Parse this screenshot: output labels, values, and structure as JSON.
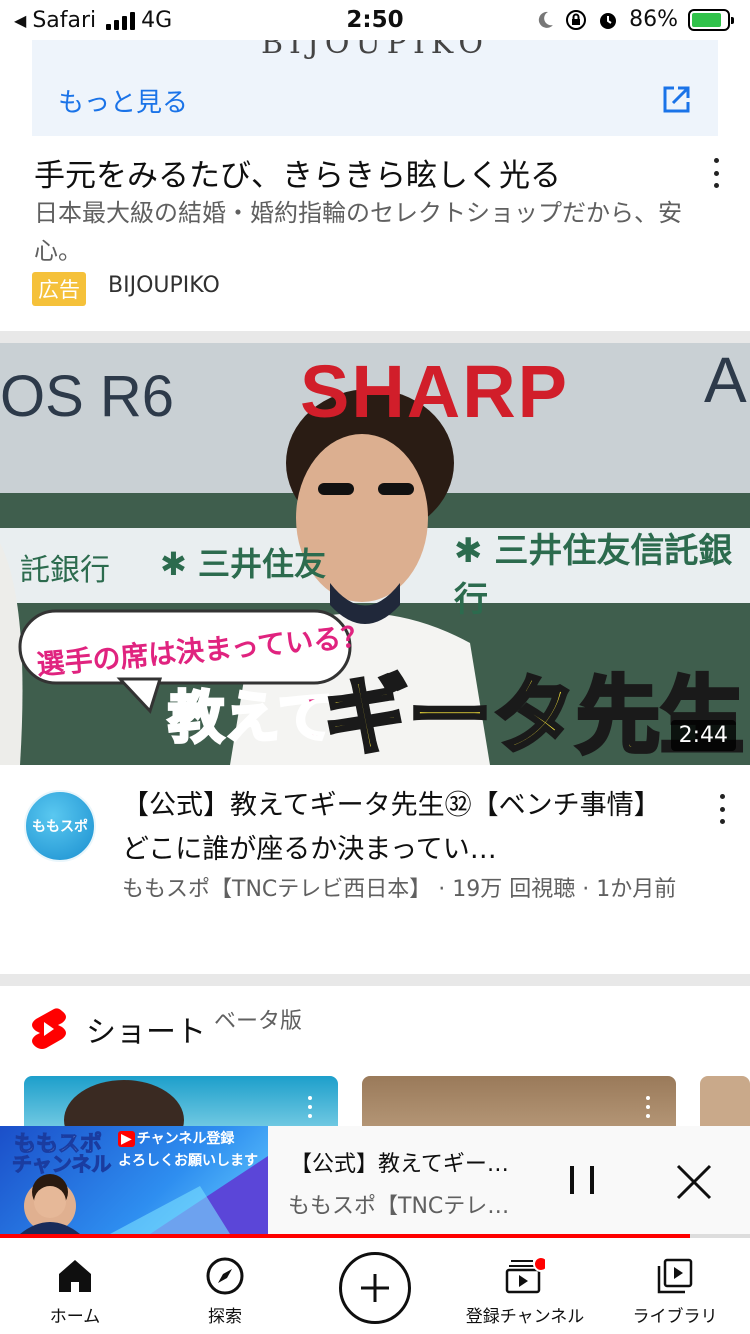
{
  "status_bar": {
    "back_app": "Safari",
    "network": "4G",
    "time": "2:50",
    "battery_percent": "86%",
    "battery_level": 0.86
  },
  "ad": {
    "brand_strip": "BIJOUPIKO",
    "more_label": "もっと見る",
    "title": "手元をみるたび、きらきら眩しく光る",
    "description": "日本最大級の結婚・婚約指輪のセレクトショップだから、安心。",
    "badge": "広告",
    "advertiser": "BIJOUPIKO",
    "badge_color": "#f5c13a",
    "link_color": "#1a73e8"
  },
  "video": {
    "duration": "2:44",
    "thumbnail_texts": {
      "sign": "SHARP",
      "left_sign": "OS R6",
      "banner_top": "三井住友信託銀行",
      "banner_left": "託銀行",
      "bubble": "選手の席は決まっている？",
      "headline_small": "教えて",
      "headline_big": "ギータ先生"
    },
    "channel_avatar_text": "ももスポ",
    "title": "【公式】教えてギータ先生㉜【ベンチ事情】どこに誰が座るか決まってい…",
    "meta": "ももスポ【TNCテレビ西日本】 · 19万 回視聴 · 1か月前"
  },
  "shorts": {
    "title": "ショート",
    "beta": "ベータ版"
  },
  "mini_player": {
    "title": "【公式】教えてギー…",
    "channel": "ももスポ【TNCテレ…",
    "thumb_texts": {
      "line1": "ももスポ",
      "line2": "チャンネル",
      "subscribe": "チャンネル登録",
      "request": "よろしくお願いします"
    },
    "progress": 0.92,
    "progress_color": "#ff0000"
  },
  "nav": {
    "home": "ホーム",
    "explore": "探索",
    "subscriptions": "登録チャンネル",
    "library": "ライブラリ"
  }
}
